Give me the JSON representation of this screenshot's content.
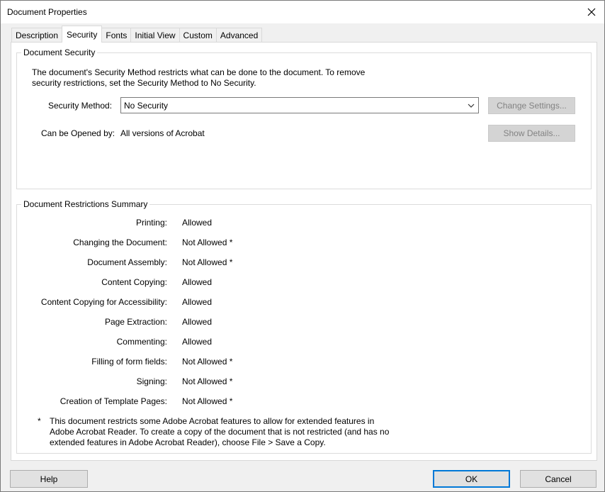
{
  "window": {
    "title": "Document Properties"
  },
  "tabs": [
    {
      "label": "Description"
    },
    {
      "label": "Security"
    },
    {
      "label": "Fonts"
    },
    {
      "label": "Initial View"
    },
    {
      "label": "Custom"
    },
    {
      "label": "Advanced"
    }
  ],
  "active_tab": "Security",
  "security": {
    "legend": "Document Security",
    "description": "The document's Security Method restricts what can be done to the document. To remove security restrictions, set the Security Method to No Security.",
    "method_label": "Security Method:",
    "method_value": "No Security",
    "opened_by_label": "Can be Opened by:",
    "opened_by_value": "All versions of Acrobat",
    "change_settings": "Change Settings...",
    "show_details": "Show Details..."
  },
  "restrictions": {
    "legend": "Document Restrictions Summary",
    "rows": [
      {
        "label": "Printing:",
        "value": "Allowed"
      },
      {
        "label": "Changing the Document:",
        "value": "Not Allowed *"
      },
      {
        "label": "Document Assembly:",
        "value": "Not Allowed *"
      },
      {
        "label": "Content Copying:",
        "value": "Allowed"
      },
      {
        "label": "Content Copying for Accessibility:",
        "value": "Allowed"
      },
      {
        "label": "Page Extraction:",
        "value": "Allowed"
      },
      {
        "label": "Commenting:",
        "value": "Allowed"
      },
      {
        "label": "Filling of form fields:",
        "value": "Not Allowed *"
      },
      {
        "label": "Signing:",
        "value": "Not Allowed *"
      },
      {
        "label": "Creation of Template Pages:",
        "value": "Not Allowed *"
      }
    ],
    "note_marker": "*",
    "note": "This document restricts some Adobe Acrobat features to allow for extended features in Adobe Acrobat Reader. To create a copy of the document that is not restricted (and has no extended features in Adobe Acrobat Reader), choose File > Save a Copy."
  },
  "footer": {
    "help": "Help",
    "ok": "OK",
    "cancel": "Cancel"
  },
  "colors": {
    "default_button_border": "#0078d7",
    "disabled_text": "#838383"
  }
}
